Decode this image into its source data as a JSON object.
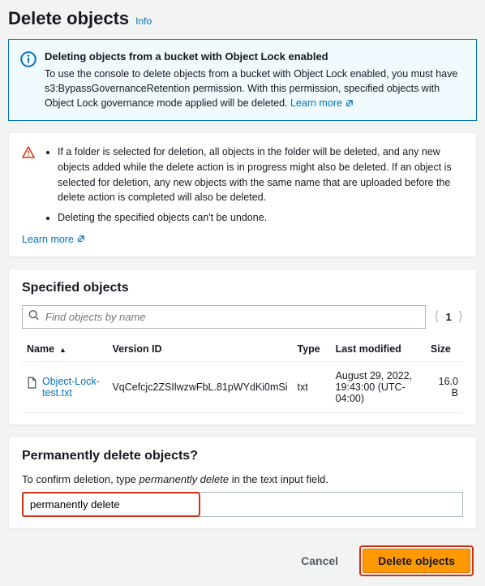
{
  "header": {
    "title": "Delete objects",
    "info": "Info"
  },
  "lockAlert": {
    "title": "Deleting objects from a bucket with Object Lock enabled",
    "body": "To use the console to delete objects from a bucket with Object Lock enabled, you must have s3:BypassGovernanceRetention permission. With this permission, specified objects with Object Lock governance mode applied will be deleted.",
    "learn": "Learn more"
  },
  "warnings": {
    "items": [
      "If a folder is selected for deletion, all objects in the folder will be deleted, and any new objects added while the delete action is in progress might also be deleted. If an object is selected for deletion, any new objects with the same name that are uploaded before the delete action is completed will also be deleted.",
      "Deleting the specified objects can't be undone."
    ],
    "learn": "Learn more"
  },
  "specified": {
    "title": "Specified objects",
    "searchPlaceholder": "Find objects by name",
    "page": "1",
    "columns": {
      "name": "Name",
      "version": "Version ID",
      "type": "Type",
      "modified": "Last modified",
      "size": "Size"
    },
    "rows": [
      {
        "name": "Object-Lock-test.txt",
        "version": "VqCefcjc2ZSIlwzwFbL.81pWYdKi0mSi",
        "type": "txt",
        "modified": "August 29, 2022, 19:43:00 (UTC-04:00)",
        "size": "16.0 B"
      }
    ]
  },
  "confirm": {
    "title": "Permanently delete objects?",
    "prompt_pre": "To confirm deletion, type ",
    "prompt_em": "permanently delete",
    "prompt_post": " in the text input field.",
    "value": "permanently delete"
  },
  "footer": {
    "cancel": "Cancel",
    "submit": "Delete objects"
  }
}
